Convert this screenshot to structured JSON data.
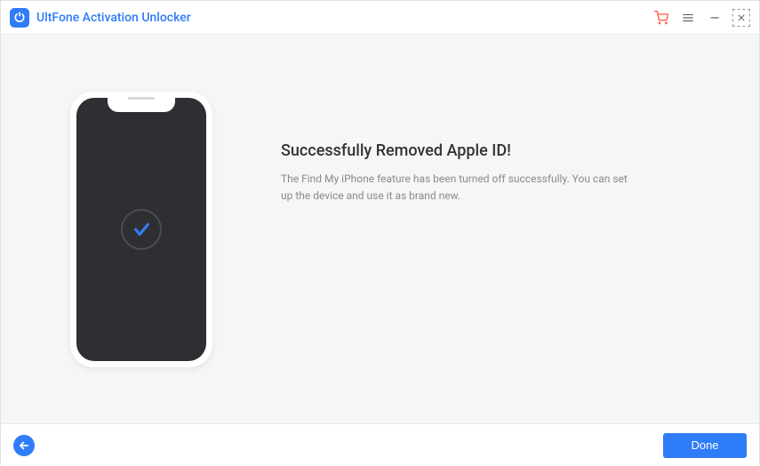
{
  "app": {
    "title": "UltFone Activation Unlocker"
  },
  "main": {
    "heading": "Successfully Removed Apple ID!",
    "description": "The Find My iPhone feature has been turned off successfully. You can set up the device and use it as brand new."
  },
  "footer": {
    "done_label": "Done"
  },
  "colors": {
    "primary": "#2f7cf8"
  }
}
